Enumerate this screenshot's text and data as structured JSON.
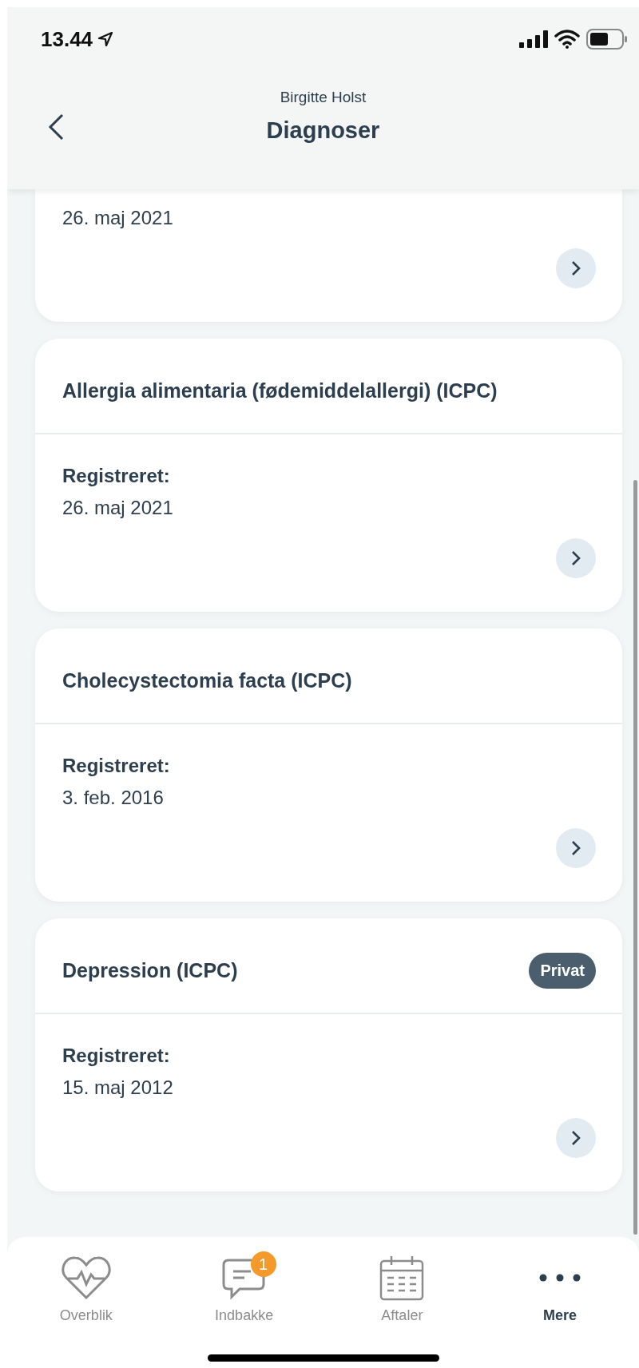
{
  "status_bar": {
    "time": "13.44"
  },
  "header": {
    "subtitle": "Birgitte Holst",
    "title": "Diagnoser"
  },
  "diagnoses": [
    {
      "date": "26. maj 2021"
    },
    {
      "title": "Allergia alimentaria (fødemiddelallergi) (ICPC)",
      "label": "Registreret:",
      "date": "26. maj 2021",
      "private": false
    },
    {
      "title": "Cholecystectomia facta (ICPC)",
      "label": "Registreret:",
      "date": "3. feb. 2016",
      "private": false
    },
    {
      "title": "Depression (ICPC)",
      "label": "Registreret:",
      "date": "15. maj 2012",
      "private": true,
      "badge": "Privat"
    }
  ],
  "tab_bar": [
    {
      "kind": "heart",
      "label": "Overblik",
      "selected": false
    },
    {
      "kind": "inbox",
      "label": "Indbakke",
      "selected": false,
      "badge": "1"
    },
    {
      "kind": "calendar",
      "label": "Aftaler",
      "selected": false
    },
    {
      "kind": "more",
      "label": "Mere",
      "selected": true
    }
  ]
}
